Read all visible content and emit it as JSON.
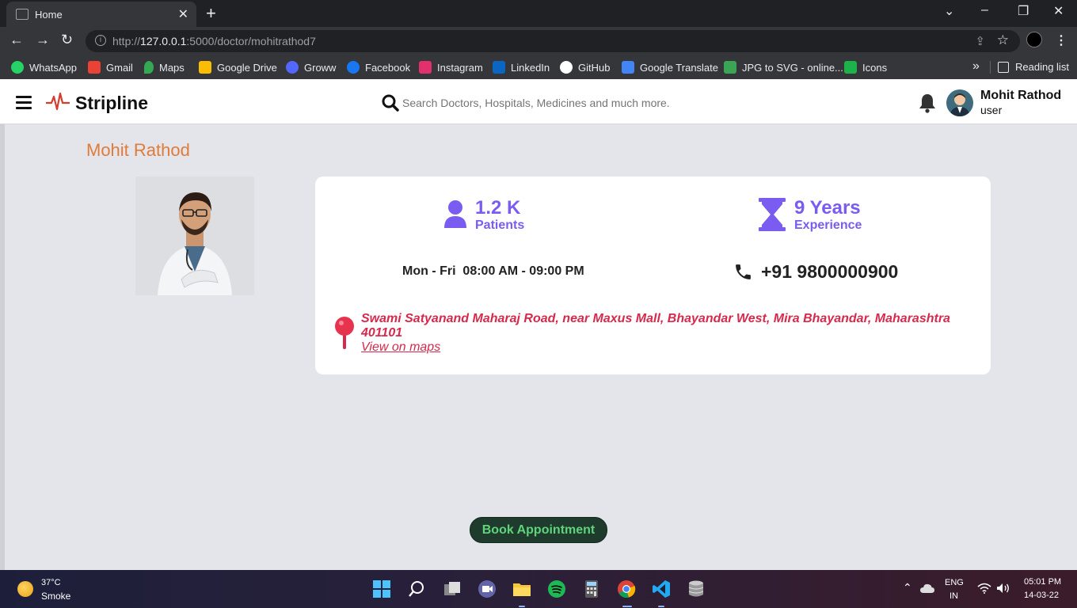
{
  "browser": {
    "tab_title": "Home",
    "url_host": "127.0.0.1",
    "url_prefix": "http://",
    "url_path": ":5000/doctor/mohitrathod7"
  },
  "bookmarks": [
    {
      "label": "WhatsApp",
      "color": "#25d366"
    },
    {
      "label": "Gmail",
      "color": "#ea4335"
    },
    {
      "label": "Maps",
      "color": "#34a853"
    },
    {
      "label": "Google Drive",
      "color": "#fbbc04"
    },
    {
      "label": "Groww",
      "color": "#5367ff"
    },
    {
      "label": "Facebook",
      "color": "#1877f2"
    },
    {
      "label": "Instagram",
      "color": "#e1306c"
    },
    {
      "label": "LinkedIn",
      "color": "#0a66c2"
    },
    {
      "label": "GitHub",
      "color": "#ffffff"
    },
    {
      "label": "Google Translate",
      "color": "#4285f4"
    },
    {
      "label": "JPG to SVG - online...",
      "color": "#3aa655"
    },
    {
      "label": "Icons",
      "color": "#1cb34a"
    }
  ],
  "reading_list": "Reading list",
  "app": {
    "brand": "Stripline",
    "search_placeholder": "Search Doctors, Hospitals, Medicines and much more.",
    "user_name": "Mohit Rathod",
    "user_role": "user"
  },
  "doctor": {
    "name": "Mohit Rathod",
    "patients_value": "1.2 K",
    "patients_label": "Patients",
    "experience_value": "9 Years",
    "experience_label": "Experience",
    "hours": "Mon - Fri  08:00 AM - 09:00 PM",
    "phone": "+91 9800000900",
    "address": "Swami Satyanand Maharaj Road, near Maxus Mall, Bhayandar West, Mira Bhayandar, Maharashtra 401101",
    "maps_link": "View on maps",
    "book_button": "Book Appointment"
  },
  "colors": {
    "accent_purple": "#7a5cf0",
    "name_orange": "#e07b39",
    "address_red": "#d6294b",
    "button_green": "#5fd47a"
  },
  "taskbar": {
    "temperature": "37°C",
    "weather": "Smoke",
    "lang_line1": "ENG",
    "lang_line2": "IN",
    "time": "05:01 PM",
    "date": "14-03-22"
  }
}
